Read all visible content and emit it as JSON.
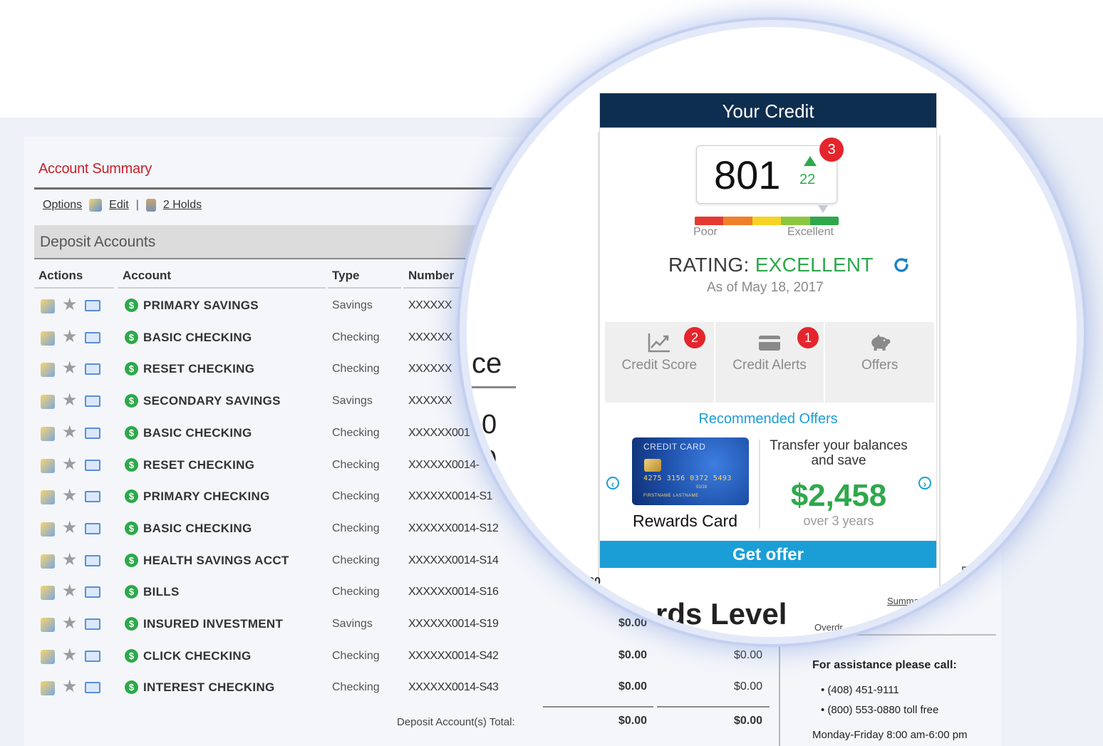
{
  "account_summary": {
    "title": "Account Summary",
    "toolbar": {
      "options": "Options",
      "edit": "Edit",
      "separator": "|",
      "holds": "2 Holds"
    },
    "section": "Deposit Accounts",
    "columns": {
      "actions": "Actions",
      "account": "Account",
      "type": "Type",
      "number": "Number"
    },
    "accounts": [
      {
        "name": "PRIMARY SAVINGS",
        "type": "Savings",
        "number": "XXXXXX"
      },
      {
        "name": "BASIC CHECKING",
        "type": "Checking",
        "number": "XXXXXX"
      },
      {
        "name": "RESET CHECKING",
        "type": "Checking",
        "number": "XXXXXX"
      },
      {
        "name": "SECONDARY SAVINGS",
        "type": "Savings",
        "number": "XXXXXX"
      },
      {
        "name": "BASIC CHECKING",
        "type": "Checking",
        "number": "XXXXXX001"
      },
      {
        "name": "RESET CHECKING",
        "type": "Checking",
        "number": "XXXXXX0014-"
      },
      {
        "name": "PRIMARY CHECKING",
        "type": "Checking",
        "number": "XXXXXX0014-S1"
      },
      {
        "name": "BASIC CHECKING",
        "type": "Checking",
        "number": "XXXXXX0014-S12"
      },
      {
        "name": "HEALTH SAVINGS ACCT",
        "type": "Checking",
        "number": "XXXXXX0014-S14"
      },
      {
        "name": "BILLS",
        "type": "Checking",
        "number": "XXXXXX0014-S16"
      },
      {
        "name": "INSURED INVESTMENT",
        "type": "Savings",
        "number": "XXXXXX0014-S19",
        "balance1": "$0.00",
        "balance2": "$0.00"
      },
      {
        "name": "CLICK CHECKING",
        "type": "Checking",
        "number": "XXXXXX0014-S42",
        "balance1": "$0.00",
        "balance2": "$0.00"
      },
      {
        "name": "INTEREST CHECKING",
        "type": "Checking",
        "number": "XXXXXX0014-S43",
        "balance1": "$0.00",
        "balance2": "$0.00"
      }
    ],
    "total_label": "Deposit Account(s) Total:",
    "total1": "$0.00",
    "total2": "$0.00",
    "partial_heading": "rds Level",
    "partial_links": [
      "Summary",
      "Overdr"
    ]
  },
  "assistance": {
    "title": "For assistance please call:",
    "phones": [
      "(408) 451-9111",
      "(800) 553-0880 toll free"
    ],
    "hours": "Monday-Friday 8:00 am-6:00 pm"
  },
  "magnified_fragments": {
    "ce": "ce",
    "digit1": "0",
    "digit2": "0",
    "bottom_text": "rds Level",
    "bottom_num": "$0.00",
    "link1": "Summary",
    "link2": "Summary",
    "link3": "Overdr"
  },
  "credit": {
    "header": "Your Credit",
    "score": "801",
    "score_change": "22",
    "score_badge": "3",
    "gauge_low": "Poor",
    "gauge_high": "Excellent",
    "gauge_colors": [
      "#e53a32",
      "#f07f2a",
      "#f6d323",
      "#8cc63f",
      "#2ea84b"
    ],
    "gauge_level": 0.9,
    "rating_label": "RATING:",
    "rating_value": "EXCELLENT",
    "as_of": "As of May 18, 2017",
    "nav": [
      {
        "label": "Credit Score",
        "icon": "chart-trend-icon",
        "badge": "2"
      },
      {
        "label": "Credit Alerts",
        "icon": "credit-card-icon",
        "badge": "1"
      },
      {
        "label": "Offers",
        "icon": "piggy-bank-icon"
      }
    ],
    "recommended_title": "Recommended Offers",
    "card": {
      "brand": "CREDIT CARD",
      "number": "4275 3156 0372 5493",
      "valid": "01/19",
      "holder": "FIRSTNAME LASTNAME",
      "name": "Rewards Card"
    },
    "offer_desc": "Transfer your balances and save",
    "offer_amount": "$2,458",
    "offer_period": "over 3 years",
    "cta": "Get offer"
  },
  "colors": {
    "header_navy": "#0e2e50",
    "accent_blue": "#1b9ed6",
    "accent_green": "#2ea84b",
    "badge_red": "#e4252d",
    "summary_red": "#c8202a"
  }
}
